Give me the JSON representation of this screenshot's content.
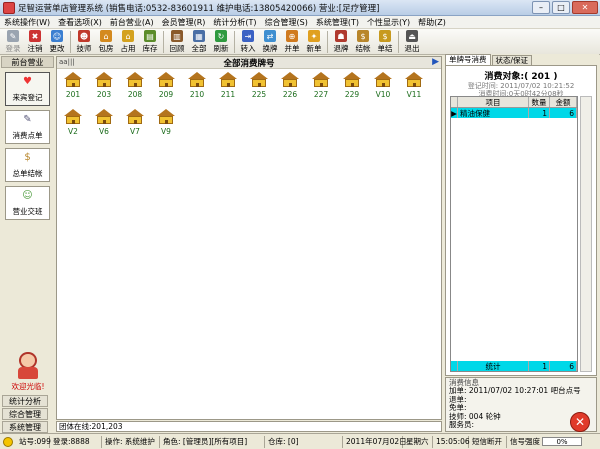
{
  "window": {
    "title": "足智运营单店管理系统 (销售电话:0532-83601911  维护电话:13805420066)      营业:[足疗管理]"
  },
  "menu": [
    "系统操作(W)",
    "查看选项(X)",
    "前台营业(A)",
    "会员管理(R)",
    "统计分析(T)",
    "综合管理(S)",
    "系统管理(T)",
    "个性显示(Y)",
    "帮助(Z)"
  ],
  "toolbar": [
    {
      "label": "登录",
      "icon": "login-icon",
      "color": "#9aa4b0",
      "disabled": true,
      "glyph": "✎"
    },
    {
      "label": "注销",
      "icon": "logout-icon",
      "color": "#cc3333",
      "glyph": "✖"
    },
    {
      "label": "更改",
      "icon": "change-icon",
      "color": "#3b7fd1",
      "glyph": "☺"
    },
    {
      "sep": true
    },
    {
      "label": "技师",
      "icon": "technician-icon",
      "color": "#c0392b",
      "glyph": "☻"
    },
    {
      "label": "包房",
      "icon": "room-icon",
      "color": "#d48a1e",
      "glyph": "⌂"
    },
    {
      "label": "占用",
      "icon": "occupy-icon",
      "color": "#d4a21e",
      "glyph": "⌂"
    },
    {
      "label": "库存",
      "icon": "stock-icon",
      "color": "#5b8c2a",
      "glyph": "▤"
    },
    {
      "sep": true
    },
    {
      "label": "回顾",
      "icon": "review-icon",
      "color": "#8a5a2b",
      "glyph": "▥"
    },
    {
      "label": "全部",
      "icon": "all-icon",
      "color": "#4a6fa5",
      "glyph": "▦"
    },
    {
      "label": "刷新",
      "icon": "refresh-icon",
      "color": "#2f9a3f",
      "glyph": "↻"
    },
    {
      "sep": true
    },
    {
      "label": "转入",
      "icon": "transfer-in-icon",
      "color": "#3b62c4",
      "glyph": "⇥"
    },
    {
      "label": "换牌",
      "icon": "swap-icon",
      "color": "#3f8fd0",
      "glyph": "⇄"
    },
    {
      "label": "并单",
      "icon": "merge-icon",
      "color": "#d07a1e",
      "glyph": "⊕"
    },
    {
      "label": "新单",
      "icon": "new-order-icon",
      "color": "#e0a020",
      "glyph": "✦"
    },
    {
      "sep": true
    },
    {
      "label": "退牌",
      "icon": "return-card-icon",
      "color": "#b03a2e",
      "glyph": "☗"
    },
    {
      "label": "结帐",
      "icon": "checkout-icon",
      "color": "#b8862b",
      "glyph": "$"
    },
    {
      "label": "单结",
      "icon": "single-checkout-icon",
      "color": "#c79a1f",
      "glyph": "$"
    },
    {
      "sep": true
    },
    {
      "label": "退出",
      "icon": "exit-icon",
      "color": "#555555",
      "glyph": "⏏"
    }
  ],
  "leftnav": {
    "header": "前台营业",
    "items": [
      {
        "label": "来宾登记",
        "icon": "guest-register-icon",
        "color": "#e33",
        "glyph": "♥",
        "active": true
      },
      {
        "label": "消费点单",
        "icon": "order-icon",
        "color": "#557",
        "glyph": "✎"
      },
      {
        "label": "总单结帐",
        "icon": "total-checkout-icon",
        "color": "#b8862b",
        "glyph": "$"
      },
      {
        "label": "营业交班",
        "icon": "shift-handover-icon",
        "color": "#4a9a3a",
        "glyph": "☺"
      }
    ],
    "welcome": "欢迎光临!",
    "bottom": [
      "统计分析",
      "综合管理",
      "系统管理"
    ]
  },
  "main": {
    "sort_label": "aa|||",
    "title": "全部消费牌号",
    "rooms_row1": [
      "201",
      "203",
      "208",
      "209",
      "210",
      "211",
      "225",
      "226",
      "227",
      "229",
      "V10",
      "V11"
    ],
    "rooms_row2": [
      "V2",
      "V6",
      "V7",
      "V9"
    ],
    "group_online": "团体在线:201,203"
  },
  "right": {
    "tabs": [
      "单牌号消费",
      "状态/保证"
    ],
    "consume_title": "消费对象:( 201 )",
    "register_time": "登记时间: 2011/07/02  10:21:52",
    "duration": "消费时间:0天0时42分08秒",
    "columns": [
      "项目",
      "数量",
      "金额"
    ],
    "rows": [
      {
        "item": "精油保健",
        "qty": "1",
        "amount": "6"
      }
    ],
    "footer": {
      "label": "统计",
      "qty": "1",
      "amount": "6"
    },
    "info_title": "消费信息",
    "info_lines": [
      "加单: 2011/07/02     10:27:01  吧台点号",
      "退单:",
      "免单:",
      "技师: 004              轮钟",
      "服务员:"
    ]
  },
  "status": {
    "station": "站号:099",
    "login": "登录:8888",
    "operation": "操作: 系统维护",
    "role": "角色: [管理员][所有项目]",
    "warehouse": "仓库: [0]",
    "date": "2011年07月02日",
    "weekday": "星期六",
    "time": "15:05:06",
    "sms": "短信断开",
    "signal": "信号强度",
    "progress": "0%"
  }
}
